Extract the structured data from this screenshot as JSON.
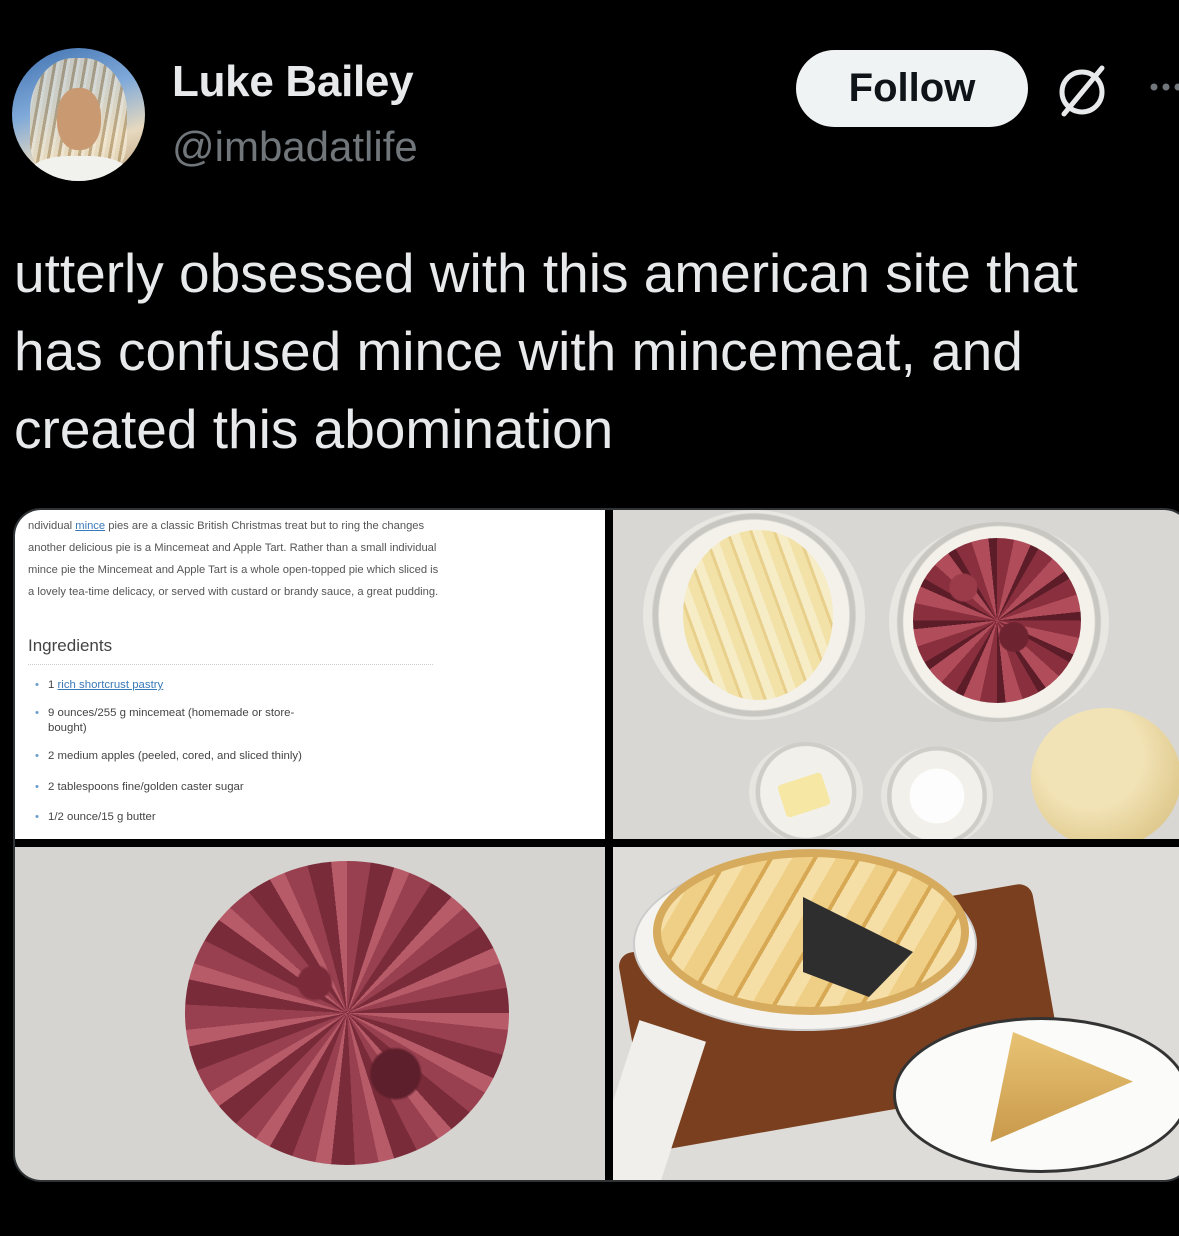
{
  "user": {
    "name": "Luke Bailey",
    "handle": "@imbadatlife"
  },
  "actions": {
    "follow_label": "Follow"
  },
  "icons": {
    "grok": "grok-icon",
    "more": "more-icon"
  },
  "post": {
    "text_lines": [
      "utterly obsessed with this american site that",
      "has confused mince with mincemeat, and",
      "created this abomination"
    ]
  },
  "media": {
    "recipe": {
      "intro_lines": [
        "ndividual",
        "mince",
        "pies are a classic British Christmas treat but to ring the changes",
        "another delicious pie is a Mincemeat and Apple Tart. Rather than a small individual",
        "mince pie the Mincemeat and Apple Tart is a whole open-topped pie which sliced is",
        "a lovely tea-time delicacy, or served with custard or brandy sauce, a great pudding."
      ],
      "ingredients_heading": "Ingredients",
      "ingredients": [
        {
          "qty": "1",
          "link": "rich shortcrust pastry"
        },
        {
          "text": "9 ounces/255 g mincemeat (homemade or store-bought)"
        },
        {
          "text": "2 medium apples (peeled, cored, and sliced thinly)"
        },
        {
          "text": "2 tablespoons fine/golden caster sugar"
        },
        {
          "text": "1/2 ounce/15 g butter"
        }
      ]
    }
  }
}
